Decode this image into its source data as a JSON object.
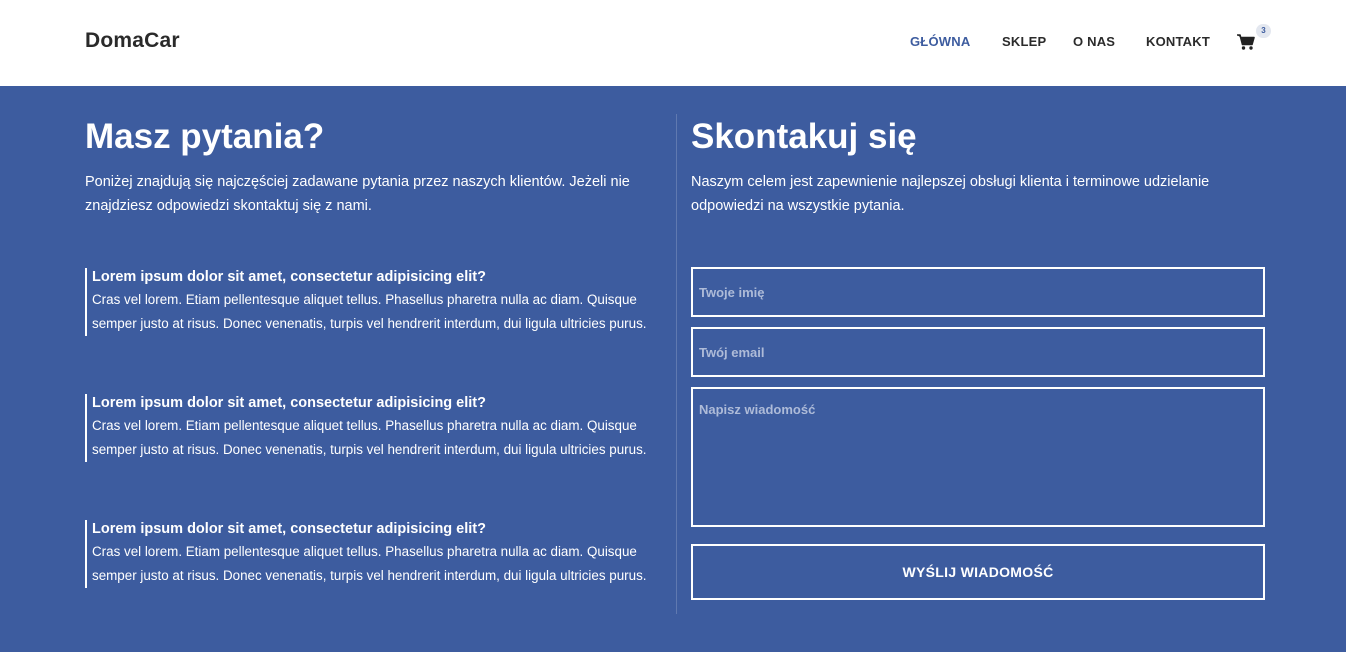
{
  "header": {
    "logo": "DomaCar",
    "nav": [
      {
        "label": "GŁÓWNA",
        "active": true
      },
      {
        "label": "SKLEP",
        "active": false
      },
      {
        "label": "O NAS",
        "active": false
      },
      {
        "label": "KONTAKT",
        "active": false
      }
    ],
    "cart": {
      "icon": "cart-icon",
      "count": "3"
    }
  },
  "faq_section": {
    "title": "Masz pytania?",
    "intro": "Poniżej znajdują się najczęściej zadawane pytania przez naszych klientów. Jeżeli nie znajdziesz odpowiedzi skontaktuj się z nami.",
    "items": [
      {
        "question": "Lorem ipsum dolor sit amet, consectetur adipisicing elit?",
        "answer": "Cras vel lorem. Etiam pellentesque aliquet tellus. Phasellus pharetra nulla ac diam. Quisque semper justo at risus. Donec venenatis, turpis vel hendrerit interdum, dui ligula ultricies purus."
      },
      {
        "question": "Lorem ipsum dolor sit amet, consectetur adipisicing elit?",
        "answer": "Cras vel lorem. Etiam pellentesque aliquet tellus. Phasellus pharetra nulla ac diam. Quisque semper justo at risus. Donec venenatis, turpis vel hendrerit interdum, dui ligula ultricies purus."
      },
      {
        "question": "Lorem ipsum dolor sit amet, consectetur adipisicing elit?",
        "answer": "Cras vel lorem. Etiam pellentesque aliquet tellus. Phasellus pharetra nulla ac diam. Quisque semper justo at risus. Donec venenatis, turpis vel hendrerit interdum, dui ligula ultricies purus."
      }
    ]
  },
  "contact_section": {
    "title": "Skontakuj się",
    "intro": "Naszym celem jest zapewnienie najlepszej obsługi klienta i terminowe udzielanie odpowiedzi na wszystkie pytania.",
    "form": {
      "name_placeholder": "Twoje imię",
      "name_value": "",
      "email_placeholder": "Twój email",
      "email_value": "",
      "message_placeholder": "Napisz wiadomość",
      "message_value": "",
      "submit_label": "WYŚLIJ WIADOMOŚĆ"
    }
  },
  "colors": {
    "brand_blue": "#3d5c9f",
    "header_bg": "#ffffff",
    "text_dark": "#2b2b2b",
    "text_light": "#ffffff",
    "placeholder": "#aebbd8"
  }
}
